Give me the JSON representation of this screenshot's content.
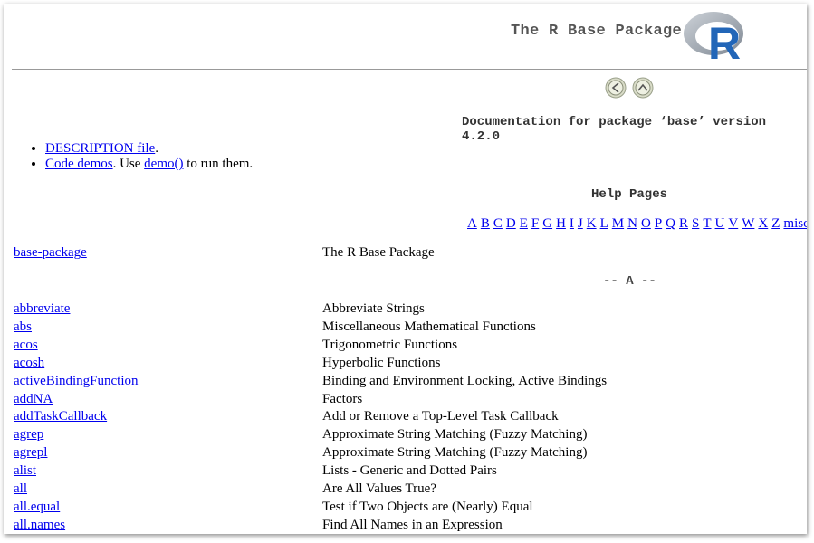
{
  "header": {
    "title": "The R Base Package",
    "logo_letter": "R"
  },
  "nav": {
    "left_icon": "circle-left-arrow-icon",
    "up_icon": "circle-up-arrow-icon"
  },
  "doc_line": "Documentation for package ‘base’ version 4.2.0",
  "links": {
    "description": "DESCRIPTION file",
    "description_suffix": ".",
    "demos": "Code demos",
    "demos_mid": ". Use ",
    "demo_fn": "demo()",
    "demos_suffix": " to run them."
  },
  "help_pages_heading": "Help Pages",
  "letters": [
    "A",
    "B",
    "C",
    "D",
    "E",
    "F",
    "G",
    "H",
    "I",
    "J",
    "K",
    "L",
    "M",
    "N",
    "O",
    "P",
    "Q",
    "R",
    "S",
    "T",
    "U",
    "V",
    "W",
    "X",
    "Z",
    "misc"
  ],
  "package_row": {
    "name": "base-package",
    "desc": "The R Base Package"
  },
  "section_a_label": "-- A --",
  "entries": [
    {
      "name": "abbreviate",
      "desc": "Abbreviate Strings"
    },
    {
      "name": "abs",
      "desc": "Miscellaneous Mathematical Functions"
    },
    {
      "name": "acos",
      "desc": "Trigonometric Functions"
    },
    {
      "name": "acosh",
      "desc": "Hyperbolic Functions"
    },
    {
      "name": "activeBindingFunction",
      "desc": "Binding and Environment Locking, Active Bindings"
    },
    {
      "name": "addNA",
      "desc": "Factors"
    },
    {
      "name": "addTaskCallback",
      "desc": "Add or Remove a Top-Level Task Callback"
    },
    {
      "name": "agrep",
      "desc": "Approximate String Matching (Fuzzy Matching)"
    },
    {
      "name": "agrepl",
      "desc": "Approximate String Matching (Fuzzy Matching)"
    },
    {
      "name": "alist",
      "desc": "Lists - Generic and Dotted Pairs"
    },
    {
      "name": "all",
      "desc": "Are All Values True?"
    },
    {
      "name": "all.equal",
      "desc": "Test if Two Objects are (Nearly) Equal"
    },
    {
      "name": "all.names",
      "desc": "Find All Names in an Expression"
    }
  ],
  "colors": {
    "link": "#0000ee",
    "logo_blue": "#2266b8",
    "logo_gray": "#9aa3ad"
  }
}
